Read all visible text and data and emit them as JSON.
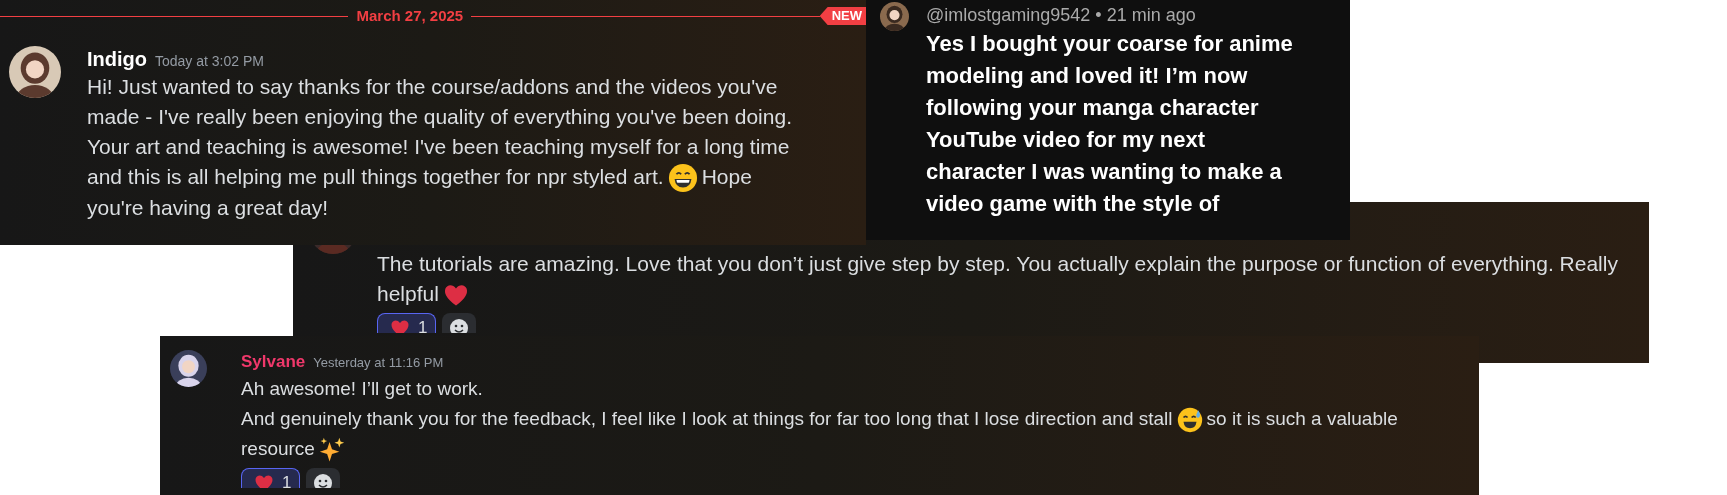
{
  "indigo_post": {
    "divider": {
      "date": "March 27, 2025",
      "badge": "NEW"
    },
    "author": "Indigo",
    "timestamp": "Today at 3:02 PM",
    "lines": [
      {
        "parts": [
          {
            "kind": "text",
            "text": "Hi! Just wanted to say thanks for the course/addons and the videos you've"
          }
        ]
      },
      {
        "parts": [
          {
            "kind": "text",
            "text": "made - I've really been enjoying the quality of everything you've been doing."
          }
        ]
      },
      {
        "parts": [
          {
            "kind": "text",
            "text": "Your art and teaching is awesome! I've been teaching myself for a long time"
          }
        ]
      },
      {
        "parts": [
          {
            "kind": "text",
            "text": "and this is all helping me pull things together for npr styled art."
          },
          {
            "kind": "grin"
          },
          {
            "kind": "text",
            "text": "Hope"
          }
        ]
      },
      {
        "parts": [
          {
            "kind": "text",
            "text": "you're having a great day!"
          }
        ]
      }
    ]
  },
  "youtube_comment": {
    "header": "@imlostgaming9542 • 21 min ago",
    "lines": [
      "Yes I bought your coarse for anime",
      "modeling and loved it! I’m now",
      "following your manga character",
      "YouTube video for my next",
      "character I was wanting to make a",
      "video game with the style of"
    ]
  },
  "tutorial_post": {
    "lines": [
      {
        "parts": [
          {
            "kind": "text",
            "text": "The tutorials are amazing. Love that you don’t just give step by step. You actually explain the purpose or function of everything. Really"
          }
        ]
      },
      {
        "parts": [
          {
            "kind": "text",
            "text": "helpful"
          },
          {
            "kind": "heart"
          }
        ]
      }
    ],
    "reactions": [
      {
        "kind": "heart",
        "count": "1",
        "selected": true
      },
      {
        "kind": "add",
        "selected": false
      }
    ]
  },
  "sylvane_post": {
    "author": "Sylvane",
    "timestamp": "Yesterday at 11:16 PM",
    "lines": [
      {
        "parts": [
          {
            "kind": "text",
            "text": "Ah awesome! I’ll get to work."
          }
        ]
      },
      {
        "parts": [
          {
            "kind": "text",
            "text": "And genuinely thank you for the feedback, I feel like I look at things for far too long that I lose direction and stall"
          },
          {
            "kind": "sweat-smile"
          },
          {
            "kind": "text",
            "text": "so it is such a valuable"
          }
        ]
      },
      {
        "parts": [
          {
            "kind": "text",
            "text": "resource"
          },
          {
            "kind": "sparkles"
          }
        ]
      }
    ],
    "reactions": [
      {
        "kind": "heart",
        "count": "1",
        "selected": true
      },
      {
        "kind": "add",
        "selected": false
      }
    ]
  }
}
